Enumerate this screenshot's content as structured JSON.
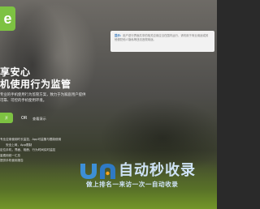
{
  "brand": {
    "logo_glyph": "e",
    "accent": "#7dc242"
  },
  "notice": {
    "label": "提示：",
    "text": "用户进行界面共享的相关应用应当在国内运行，请勿用于商业用途或其他侵犯他人隐私等违法违规用途。"
  },
  "hero": {
    "title_line1": "享安心",
    "title_line2": "机使用行为监管",
    "desc_line1": "专业的手机使用行为监管方案，致力于为家庭用户提供",
    "desc_line2": "可靠、可控的手机使用环境。",
    "cta_label": "开",
    "or_label": "OR",
    "secondary_link": "查看演示"
  },
  "features": [
    "专业应用使用时长监控，App可监管与限制使用",
    "安全上网，App限制",
    "定位手机，界面、相册、行为时间实时监控",
    "量费用统一汇总",
    "提供手机使用报告"
  ],
  "watermark": {
    "name": "自动秒收录",
    "slogan": "做上排名一来访一次一自动收录"
  }
}
